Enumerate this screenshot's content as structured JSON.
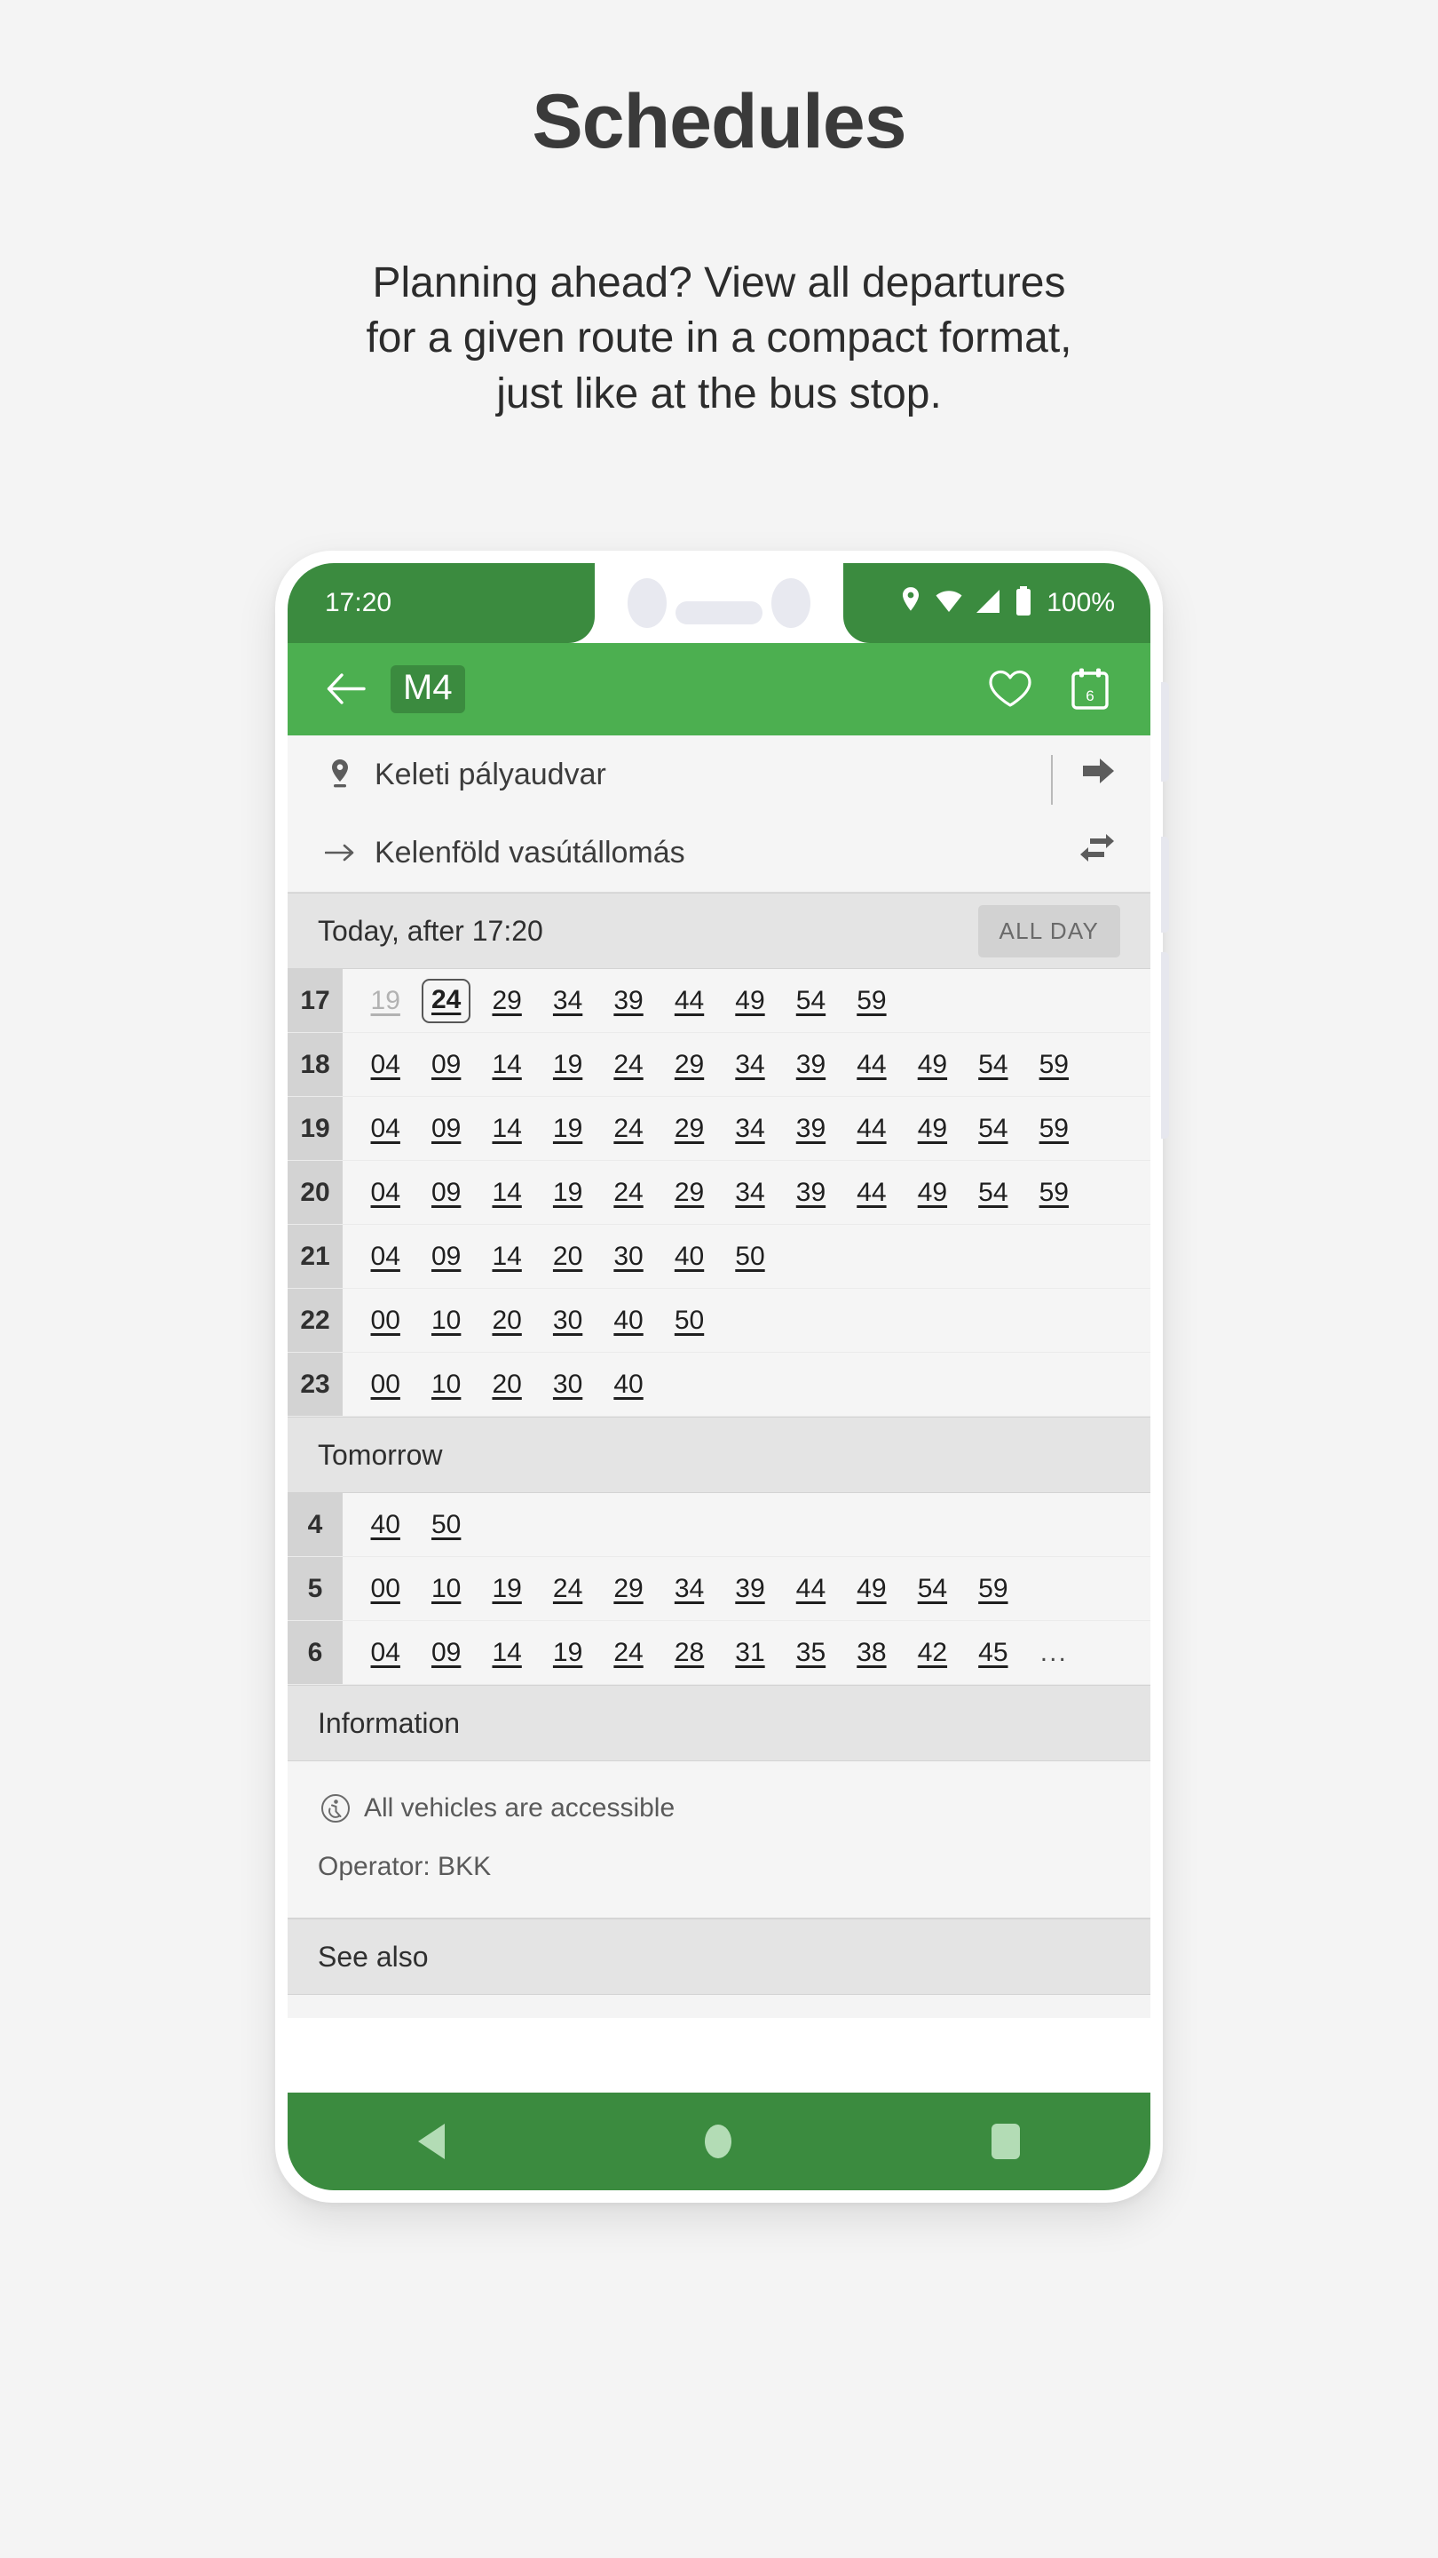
{
  "promo": {
    "title": "Schedules",
    "subtitle_lines": [
      "Planning ahead? View all departures",
      "for a given route in a compact format,",
      "just like at the bus stop."
    ]
  },
  "colors": {
    "page_background": "#f4f4f4",
    "status_bar_green": "#3b8b3f",
    "app_bar_green": "#4caf50",
    "badge_green": "#3b8b3f",
    "nav_bar_green": "#3b8b3f",
    "section_band": "#e4e4e4",
    "hour_cell": "#d3d3d3",
    "list_background": "#f5f5f5"
  },
  "status_bar": {
    "time": "17:20",
    "battery_label": "100%",
    "icons": [
      "location-pin-icon",
      "wifi-icon",
      "cellular-signal-icon",
      "battery-icon"
    ]
  },
  "app_bar": {
    "back_icon": "arrow-left-icon",
    "route_badge": "M4",
    "actions": [
      {
        "name": "favorite-button",
        "icon": "heart-icon"
      },
      {
        "name": "calendar-button",
        "icon": "calendar-icon",
        "day_number": "6"
      }
    ]
  },
  "route_header": {
    "origin": {
      "icon": "location-pin-icon",
      "name": "Keleti pályaudvar"
    },
    "destination": {
      "icon": "arrow-right-small-icon",
      "name": "Kelenföld vasútállomás"
    },
    "forward_action": {
      "name": "go-forward-button",
      "icon": "arrow-right-bold-icon"
    },
    "swap_action": {
      "name": "swap-direction-button",
      "icon": "swap-arrows-icon"
    }
  },
  "today_section": {
    "label": "Today, after 17:20",
    "all_day_button": "ALL DAY",
    "rows": [
      {
        "hour": "17",
        "minutes": [
          {
            "v": "19",
            "state": "past"
          },
          {
            "v": "24",
            "state": "selected"
          },
          {
            "v": "29",
            "state": "normal"
          },
          {
            "v": "34",
            "state": "normal"
          },
          {
            "v": "39",
            "state": "normal"
          },
          {
            "v": "44",
            "state": "normal"
          },
          {
            "v": "49",
            "state": "normal"
          },
          {
            "v": "54",
            "state": "normal"
          },
          {
            "v": "59",
            "state": "normal"
          }
        ]
      },
      {
        "hour": "18",
        "minutes": [
          {
            "v": "04",
            "state": "normal"
          },
          {
            "v": "09",
            "state": "normal"
          },
          {
            "v": "14",
            "state": "normal"
          },
          {
            "v": "19",
            "state": "normal"
          },
          {
            "v": "24",
            "state": "normal"
          },
          {
            "v": "29",
            "state": "normal"
          },
          {
            "v": "34",
            "state": "normal"
          },
          {
            "v": "39",
            "state": "normal"
          },
          {
            "v": "44",
            "state": "normal"
          },
          {
            "v": "49",
            "state": "normal"
          },
          {
            "v": "54",
            "state": "normal"
          },
          {
            "v": "59",
            "state": "normal"
          }
        ]
      },
      {
        "hour": "19",
        "minutes": [
          {
            "v": "04",
            "state": "normal"
          },
          {
            "v": "09",
            "state": "normal"
          },
          {
            "v": "14",
            "state": "normal"
          },
          {
            "v": "19",
            "state": "normal"
          },
          {
            "v": "24",
            "state": "normal"
          },
          {
            "v": "29",
            "state": "normal"
          },
          {
            "v": "34",
            "state": "normal"
          },
          {
            "v": "39",
            "state": "normal"
          },
          {
            "v": "44",
            "state": "normal"
          },
          {
            "v": "49",
            "state": "normal"
          },
          {
            "v": "54",
            "state": "normal"
          },
          {
            "v": "59",
            "state": "normal"
          }
        ]
      },
      {
        "hour": "20",
        "minutes": [
          {
            "v": "04",
            "state": "normal"
          },
          {
            "v": "09",
            "state": "normal"
          },
          {
            "v": "14",
            "state": "normal"
          },
          {
            "v": "19",
            "state": "normal"
          },
          {
            "v": "24",
            "state": "normal"
          },
          {
            "v": "29",
            "state": "normal"
          },
          {
            "v": "34",
            "state": "normal"
          },
          {
            "v": "39",
            "state": "normal"
          },
          {
            "v": "44",
            "state": "normal"
          },
          {
            "v": "49",
            "state": "normal"
          },
          {
            "v": "54",
            "state": "normal"
          },
          {
            "v": "59",
            "state": "normal"
          }
        ]
      },
      {
        "hour": "21",
        "minutes": [
          {
            "v": "04",
            "state": "normal"
          },
          {
            "v": "09",
            "state": "normal"
          },
          {
            "v": "14",
            "state": "normal"
          },
          {
            "v": "20",
            "state": "normal"
          },
          {
            "v": "30",
            "state": "normal"
          },
          {
            "v": "40",
            "state": "normal"
          },
          {
            "v": "50",
            "state": "normal"
          }
        ]
      },
      {
        "hour": "22",
        "minutes": [
          {
            "v": "00",
            "state": "normal"
          },
          {
            "v": "10",
            "state": "normal"
          },
          {
            "v": "20",
            "state": "normal"
          },
          {
            "v": "30",
            "state": "normal"
          },
          {
            "v": "40",
            "state": "normal"
          },
          {
            "v": "50",
            "state": "normal"
          }
        ]
      },
      {
        "hour": "23",
        "minutes": [
          {
            "v": "00",
            "state": "normal"
          },
          {
            "v": "10",
            "state": "normal"
          },
          {
            "v": "20",
            "state": "normal"
          },
          {
            "v": "30",
            "state": "normal"
          },
          {
            "v": "40",
            "state": "normal"
          }
        ]
      }
    ]
  },
  "tomorrow_section": {
    "label": "Tomorrow",
    "rows": [
      {
        "hour": "4",
        "minutes": [
          {
            "v": "40",
            "state": "normal"
          },
          {
            "v": "50",
            "state": "normal"
          }
        ]
      },
      {
        "hour": "5",
        "minutes": [
          {
            "v": "00",
            "state": "normal"
          },
          {
            "v": "10",
            "state": "normal"
          },
          {
            "v": "19",
            "state": "normal"
          },
          {
            "v": "24",
            "state": "normal"
          },
          {
            "v": "29",
            "state": "normal"
          },
          {
            "v": "34",
            "state": "normal"
          },
          {
            "v": "39",
            "state": "normal"
          },
          {
            "v": "44",
            "state": "normal"
          },
          {
            "v": "49",
            "state": "normal"
          },
          {
            "v": "54",
            "state": "normal"
          },
          {
            "v": "59",
            "state": "normal"
          }
        ]
      },
      {
        "hour": "6",
        "minutes": [
          {
            "v": "04",
            "state": "normal"
          },
          {
            "v": "09",
            "state": "normal"
          },
          {
            "v": "14",
            "state": "normal"
          },
          {
            "v": "19",
            "state": "normal"
          },
          {
            "v": "24",
            "state": "normal"
          },
          {
            "v": "28",
            "state": "normal"
          },
          {
            "v": "31",
            "state": "normal"
          },
          {
            "v": "35",
            "state": "normal"
          },
          {
            "v": "38",
            "state": "normal"
          },
          {
            "v": "42",
            "state": "normal"
          },
          {
            "v": "45",
            "state": "normal"
          },
          {
            "v": "...",
            "state": "ellipsis"
          }
        ]
      }
    ]
  },
  "information_section": {
    "label": "Information",
    "accessibility": {
      "icon": "wheelchair-accessible-icon",
      "text": "All vehicles are accessible"
    },
    "operator": "Operator: BKK"
  },
  "see_also_section": {
    "label": "See also"
  },
  "nav_bar": {
    "back": "back-triangle-icon",
    "home": "home-circle-icon",
    "recents": "recents-square-icon"
  }
}
